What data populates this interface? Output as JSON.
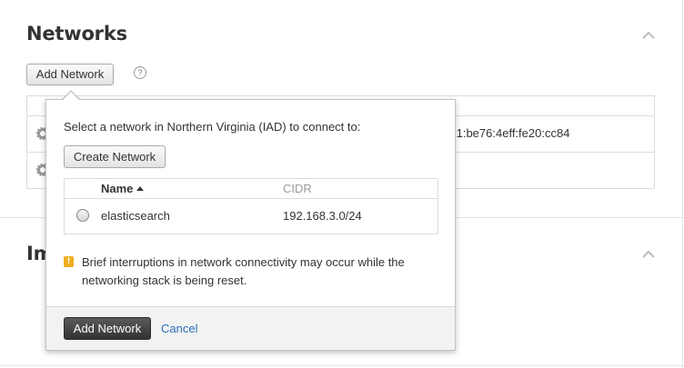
{
  "networks_section": {
    "title": "Networks",
    "add_network_label": "Add Network",
    "help_glyph": "?",
    "table_visible_text": ":1:be76:4eff:fe20:cc84"
  },
  "next_section": {
    "title": "Images"
  },
  "popover": {
    "prompt": "Select a network in Northern Virginia (IAD) to connect to:",
    "create_network_label": "Create Network",
    "table": {
      "columns": [
        "Name",
        "CIDR"
      ],
      "sort_column": "Name",
      "sort_direction": "ascending",
      "rows": [
        {
          "name": "elasticsearch",
          "cidr": "192.168.3.0/24",
          "selected": false
        }
      ]
    },
    "warning": "Brief interruptions in network connectivity may occur while the networking stack is being reset.",
    "warning_glyph": "!",
    "submit_label": "Add Network",
    "cancel_label": "Cancel"
  },
  "colors": {
    "warning": "#f0ad1f",
    "link": "#2a6ebb",
    "primary_button": "#333333"
  },
  "icons": [
    "chevron-up-icon",
    "help-icon",
    "gear-icon",
    "sort-asc-icon",
    "warning-icon",
    "radio-button"
  ]
}
